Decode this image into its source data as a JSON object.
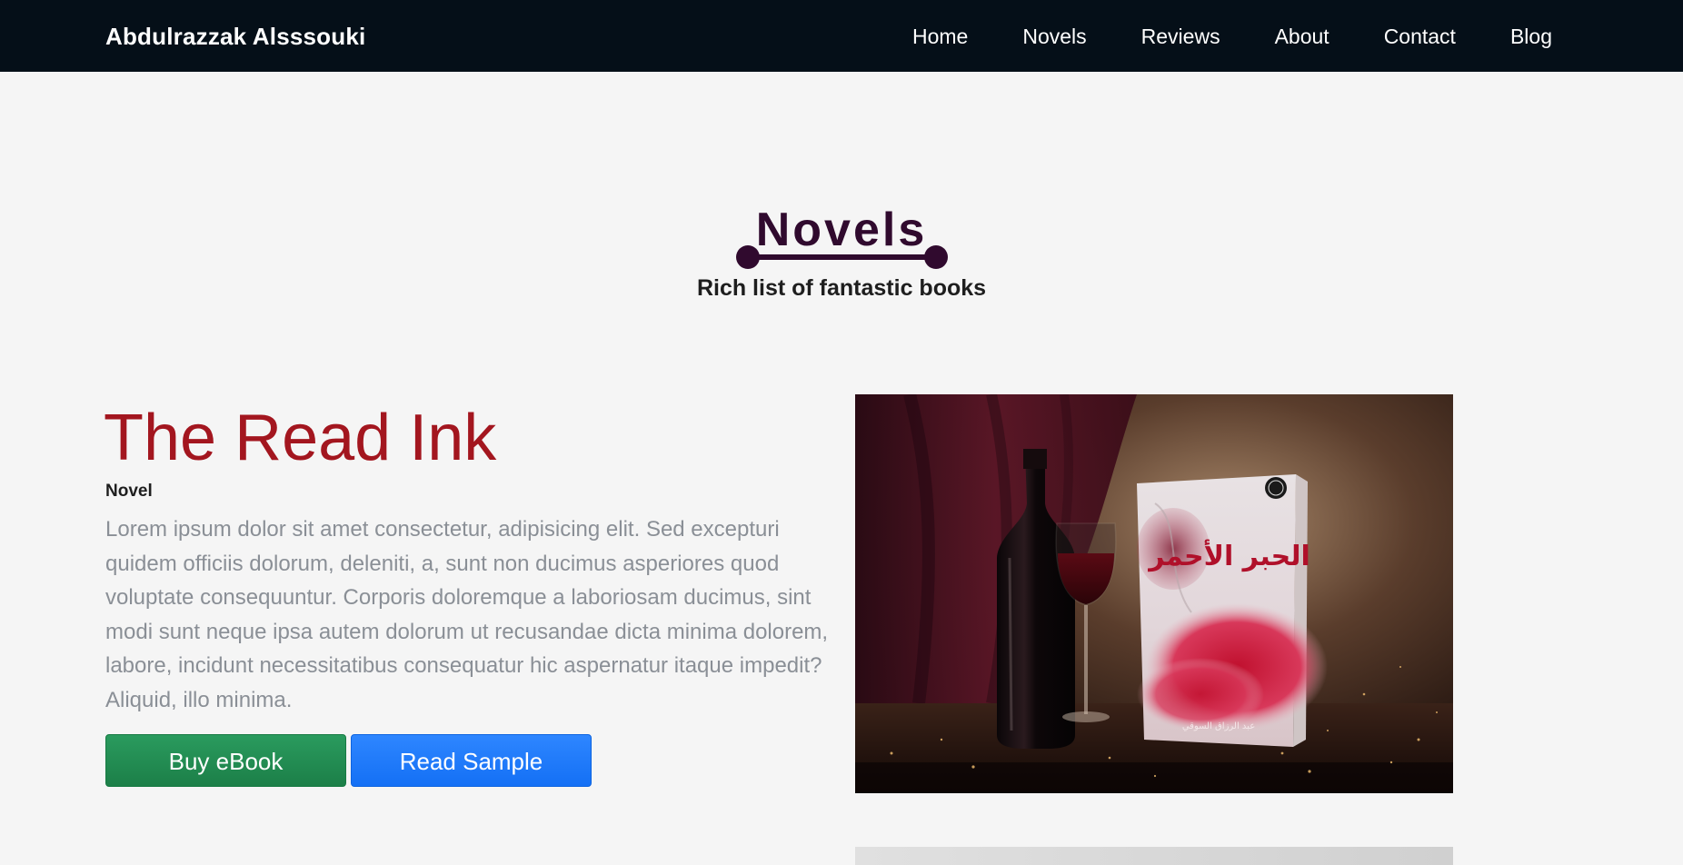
{
  "navbar": {
    "brand": "Abdulrazzak Alsssouki",
    "links": [
      "Home",
      "Novels",
      "Reviews",
      "About",
      "Contact",
      "Blog"
    ]
  },
  "section": {
    "title": "Novels",
    "subtitle": "Rich list of fantastic books"
  },
  "book": {
    "title": "The Read Ink",
    "type": "Novel",
    "description": "Lorem ipsum dolor sit amet consectetur, adipisicing elit. Sed excepturi quidem officiis dolorum, deleniti, a, sunt non ducimus asperiores quod voluptate consequuntur. Corporis doloremque a laboriosam ducimus, sint modi sunt neque ipsa autem dolorum ut recusandae dicta minima dolorem, labore, incidunt necessitatibus consequatur hic aspernatur itaque impedit? Aliquid, illo minima.",
    "buy_label": "Buy eBook",
    "sample_label": "Read Sample",
    "cover_title_ar": "الحبر الأحمر",
    "cover_author_ar": "عبد الرزاق السوقي"
  },
  "colors": {
    "navbar_bg": "#050f18",
    "accent_title": "#300a2e",
    "book_title": "#a3161f",
    "buy_button": "#1c8a4e",
    "sample_button": "#1a73fa"
  }
}
